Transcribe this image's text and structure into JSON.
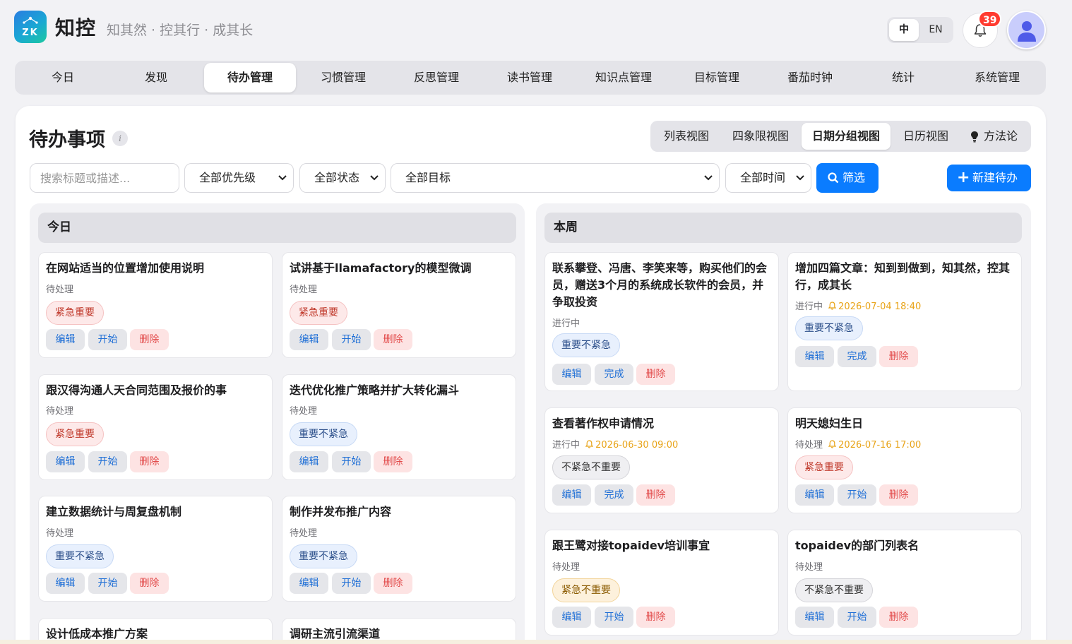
{
  "app": {
    "logo_text": "ZK",
    "name": "知控",
    "slogan": "知其然 · 控其行 · 成其长",
    "lang_zh": "中",
    "lang_en": "EN",
    "notification_count": "39"
  },
  "nav": {
    "tabs": [
      "今日",
      "发现",
      "待办管理",
      "习惯管理",
      "反思管理",
      "读书管理",
      "知识点管理",
      "目标管理",
      "番茄时钟",
      "统计",
      "系统管理"
    ],
    "active": "待办管理"
  },
  "page": {
    "title": "待办事项",
    "info_icon": "i",
    "views": [
      "列表视图",
      "四象限视图",
      "日期分组视图",
      "日历视图",
      "方法论"
    ],
    "active_view": "日期分组视图"
  },
  "filters": {
    "search_placeholder": "搜索标题或描述...",
    "priority": "全部优先级",
    "status": "全部状态",
    "goal": "全部目标",
    "time": "全部时间",
    "filter_button": "筛选",
    "new_button": "新建待办"
  },
  "actions": {
    "edit": "编辑",
    "start": "开始",
    "done": "完成",
    "delete": "删除"
  },
  "groups": [
    {
      "title": "今日",
      "tasks": [
        {
          "title": "在网站适当的位置增加使用说明",
          "status": "待处理",
          "due": "",
          "priority": "紧急重要",
          "action": "开始"
        },
        {
          "title": "试讲基于llamafactory的模型微调",
          "status": "待处理",
          "due": "",
          "priority": "紧急重要",
          "action": "开始"
        },
        {
          "title": "跟汉得沟通人天合同范围及报价的事",
          "status": "待处理",
          "due": "",
          "priority": "紧急重要",
          "action": "开始"
        },
        {
          "title": "迭代优化推广策略并扩大转化漏斗",
          "status": "待处理",
          "due": "",
          "priority": "重要不紧急",
          "action": "开始"
        },
        {
          "title": "建立数据统计与周复盘机制",
          "status": "待处理",
          "due": "",
          "priority": "重要不紧急",
          "action": "开始"
        },
        {
          "title": "制作并发布推广内容",
          "status": "待处理",
          "due": "",
          "priority": "重要不紧急",
          "action": "开始"
        },
        {
          "title": "设计低成本推广方案",
          "status": "",
          "due": "",
          "priority": "",
          "action": ""
        },
        {
          "title": "调研主流引流渠道",
          "status": "",
          "due": "",
          "priority": "",
          "action": ""
        }
      ]
    },
    {
      "title": "本周",
      "tasks": [
        {
          "title": "联系攀登、冯唐、李笑来等，购买他们的会员，赠送3个月的系统成长软件的会员，并争取投资",
          "status": "进行中",
          "due": "",
          "priority": "重要不紧急",
          "action": "完成"
        },
        {
          "title": "增加四篇文章：知到到做到，知其然，控其行，成其长",
          "status": "进行中",
          "due": "2026-07-04 18:40",
          "priority": "重要不紧急",
          "action": "完成"
        },
        {
          "title": "查看著作权申请情况",
          "status": "进行中",
          "due": "2026-06-30 09:00",
          "priority": "不紧急不重要",
          "action": "完成"
        },
        {
          "title": "明天媳妇生日",
          "status": "待处理",
          "due": "2026-07-16 17:00",
          "priority": "紧急重要",
          "action": "开始"
        },
        {
          "title": "跟王鹭对接topaidev培训事宜",
          "status": "待处理",
          "due": "",
          "priority": "紧急不重要",
          "action": "开始"
        },
        {
          "title": "topaidev的部门列表名",
          "status": "待处理",
          "due": "",
          "priority": "不紧急不重要",
          "action": "开始"
        }
      ]
    }
  ],
  "colors": {
    "accent": "#0a7cff",
    "urgent_important": "#c0392b",
    "reminder": "#e8a317",
    "badge": "#ff3b30"
  }
}
